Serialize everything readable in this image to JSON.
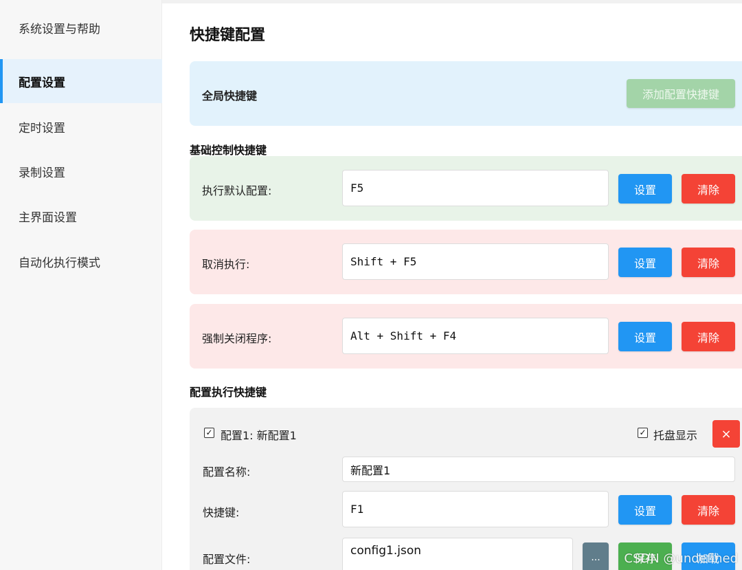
{
  "sidebar": {
    "items": [
      {
        "label": "系统设置与帮助"
      },
      {
        "label": "配置设置"
      },
      {
        "label": "定时设置"
      },
      {
        "label": "录制设置"
      },
      {
        "label": "主界面设置"
      },
      {
        "label": "自动化执行模式"
      }
    ],
    "active": "配置设置"
  },
  "main": {
    "title": "快捷键配置",
    "global": {
      "label": "全局快捷键",
      "add_button": "添加配置快捷键"
    },
    "basic": {
      "section_title": "基础控制快捷键",
      "rows": [
        {
          "label": "执行默认配置:",
          "value": "F5",
          "set": "设置",
          "clear": "清除"
        },
        {
          "label": "取消执行:",
          "value": "Shift + F5",
          "set": "设置",
          "clear": "清除"
        },
        {
          "label": "强制关闭程序:",
          "value": "Alt + Shift + F4",
          "set": "设置",
          "clear": "清除"
        }
      ]
    },
    "config_exec": {
      "section_title": "配置执行快捷键",
      "item": {
        "header": "配置1: 新配置1",
        "tray_label": "托盘显示",
        "delete_icon": "×",
        "name_label": "配置名称:",
        "name_value": "新配置1",
        "hotkey_label": "快捷键:",
        "hotkey_value": "F1",
        "set": "设置",
        "clear": "清除",
        "file_label": "配置文件:",
        "file_value": "config1.json",
        "browse": "...",
        "save": "保存",
        "load": "加载"
      }
    }
  },
  "watermark": "CSDN @undefined",
  "colors": {
    "accent_blue": "#2196f3",
    "danger_red": "#f44336",
    "success_green": "#4caf50"
  }
}
